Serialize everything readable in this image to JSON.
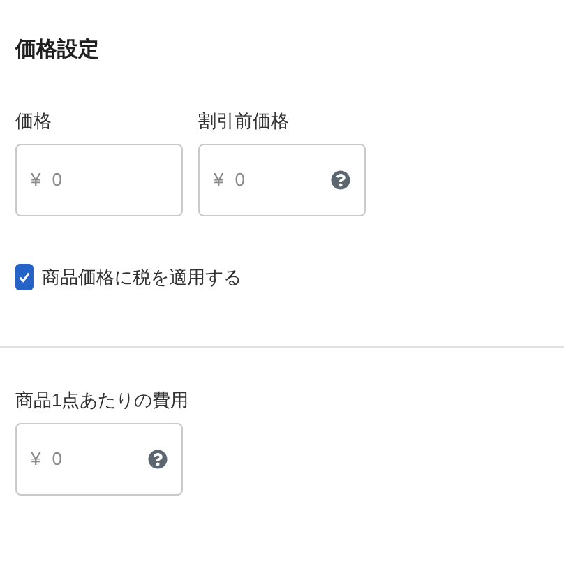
{
  "title": "価格設定",
  "price_fields": [
    {
      "label": "価格",
      "currency": "¥",
      "value": "0",
      "help": false
    },
    {
      "label": "割引前価格",
      "currency": "¥",
      "value": "0",
      "help": true
    }
  ],
  "tax_checkbox": {
    "label": "商品価格に税を適用する",
    "checked": true
  },
  "cost_field": {
    "label": "商品1点あたりの費用",
    "currency": "¥",
    "value": "0",
    "help": true
  }
}
